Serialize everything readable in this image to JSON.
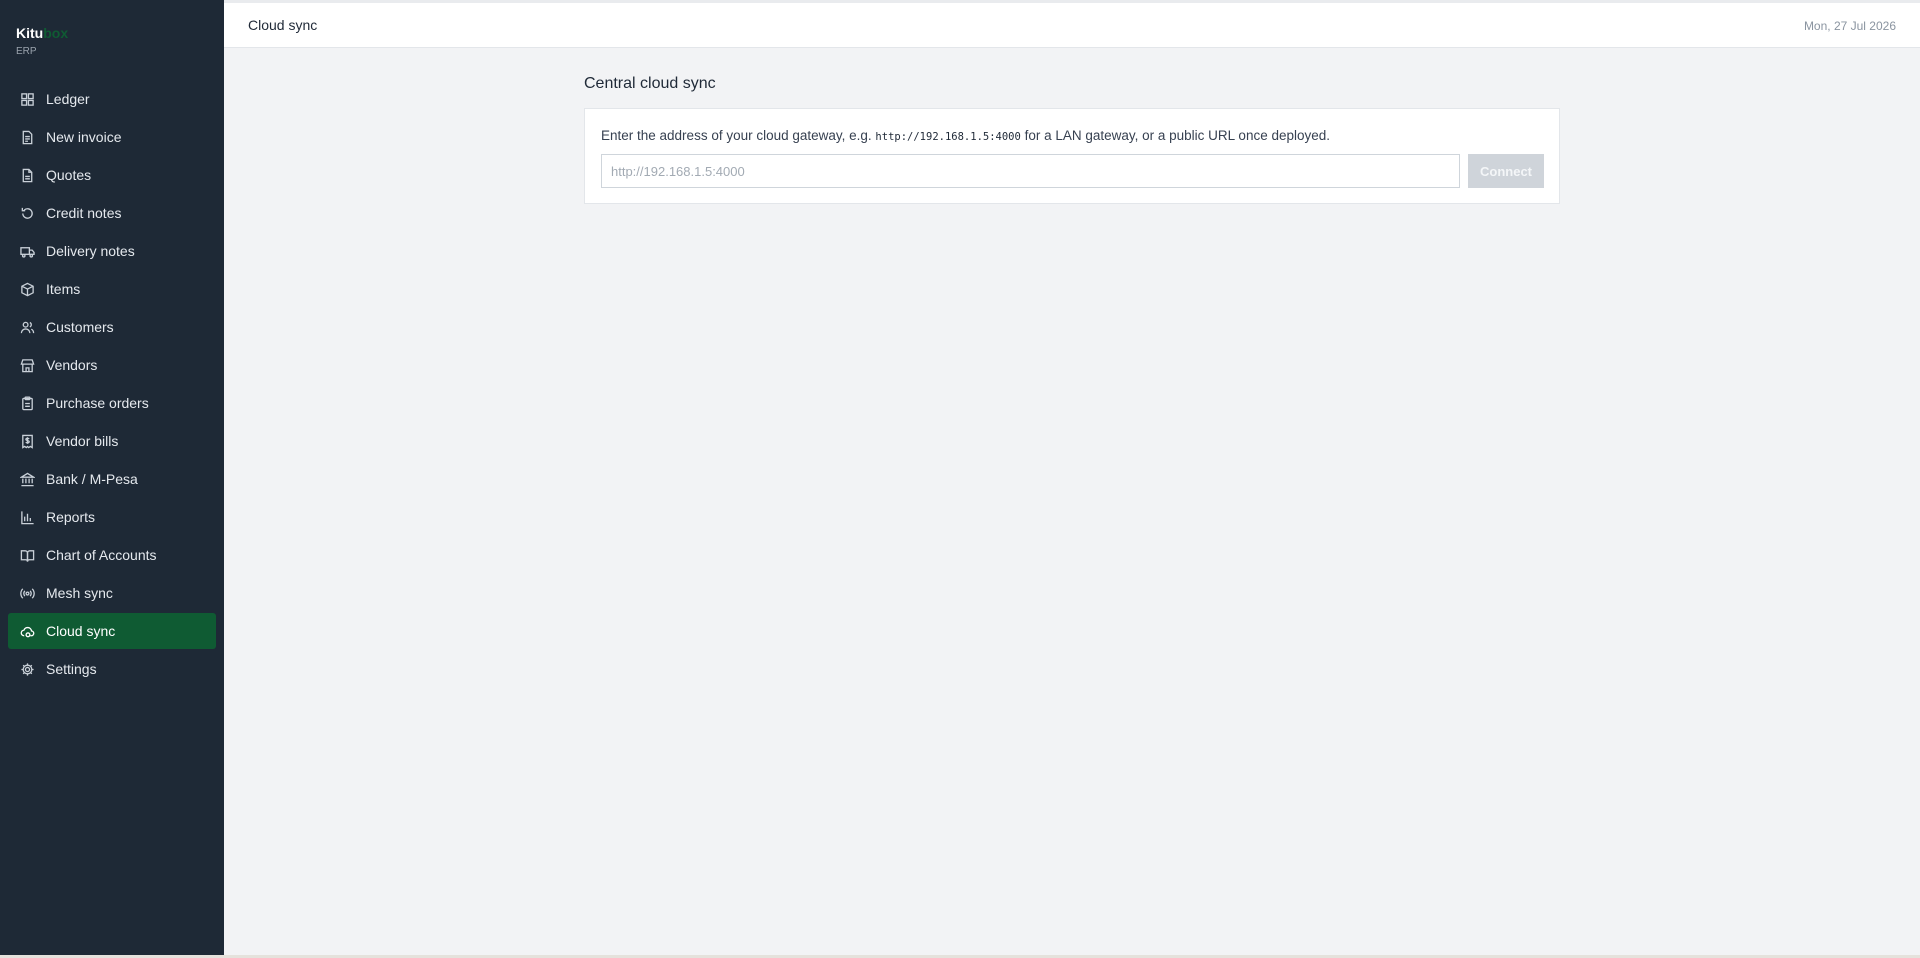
{
  "brand": {
    "name_main": "Kitu",
    "name_accent": "box",
    "subtitle": "ERP"
  },
  "sidebar": {
    "items": [
      {
        "label": "Ledger",
        "icon": "grid-icon"
      },
      {
        "label": "New invoice",
        "icon": "file-text-icon"
      },
      {
        "label": "Quotes",
        "icon": "file-icon"
      },
      {
        "label": "Credit notes",
        "icon": "rotate-ccw-icon"
      },
      {
        "label": "Delivery notes",
        "icon": "truck-icon"
      },
      {
        "label": "Items",
        "icon": "package-icon"
      },
      {
        "label": "Customers",
        "icon": "users-icon"
      },
      {
        "label": "Vendors",
        "icon": "store-icon"
      },
      {
        "label": "Purchase orders",
        "icon": "clipboard-icon"
      },
      {
        "label": "Vendor bills",
        "icon": "receipt-icon"
      },
      {
        "label": "Bank / M-Pesa",
        "icon": "bank-icon"
      },
      {
        "label": "Reports",
        "icon": "bar-chart-icon"
      },
      {
        "label": "Chart of Accounts",
        "icon": "book-open-icon"
      },
      {
        "label": "Mesh sync",
        "icon": "radio-icon"
      },
      {
        "label": "Cloud sync",
        "icon": "cloud-icon",
        "active": true
      },
      {
        "label": "Settings",
        "icon": "gear-icon"
      }
    ]
  },
  "header": {
    "title": "Cloud sync",
    "date": "Mon, 27 Jul 2026"
  },
  "main": {
    "section_title": "Central cloud sync",
    "description_before": "Enter the address of your cloud gateway, e.g. ",
    "description_code": "http://192.168.1.5:4000",
    "description_after": " for a LAN gateway, or a public URL once deployed.",
    "input_value": "",
    "input_placeholder": "http://192.168.1.5:4000",
    "connect_label": "Connect"
  },
  "colors": {
    "sidebar_bg": "#1e2936",
    "accent": "#0f5b33",
    "page_bg": "#f2f3f5",
    "button_disabled": "#cfd4da"
  }
}
